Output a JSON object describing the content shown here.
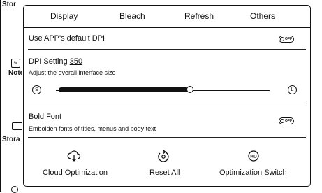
{
  "background": {
    "labels": [
      "Stor",
      "Note",
      "Stora"
    ]
  },
  "tabs": [
    "Display",
    "Bleach",
    "Refresh",
    "Others"
  ],
  "default_dpi": {
    "label": "Use APP's default DPI",
    "toggle_text": "OFF"
  },
  "dpi": {
    "label": "DPI Setting",
    "value": "350",
    "subtitle": "Adjust the overall interface size",
    "small_label": "S",
    "large_label": "L",
    "level_fraction": 0.62
  },
  "bold_font": {
    "label": "Bold Font",
    "subtitle": "Embolden fonts of titles, menus and body text",
    "toggle_text": "OFF"
  },
  "actions": [
    {
      "label": "Cloud Optimization",
      "icon": "cloud-download-icon"
    },
    {
      "label": "Reset All",
      "icon": "reset-icon"
    },
    {
      "label": "Optimization Switch",
      "icon": "hd-icon"
    }
  ]
}
